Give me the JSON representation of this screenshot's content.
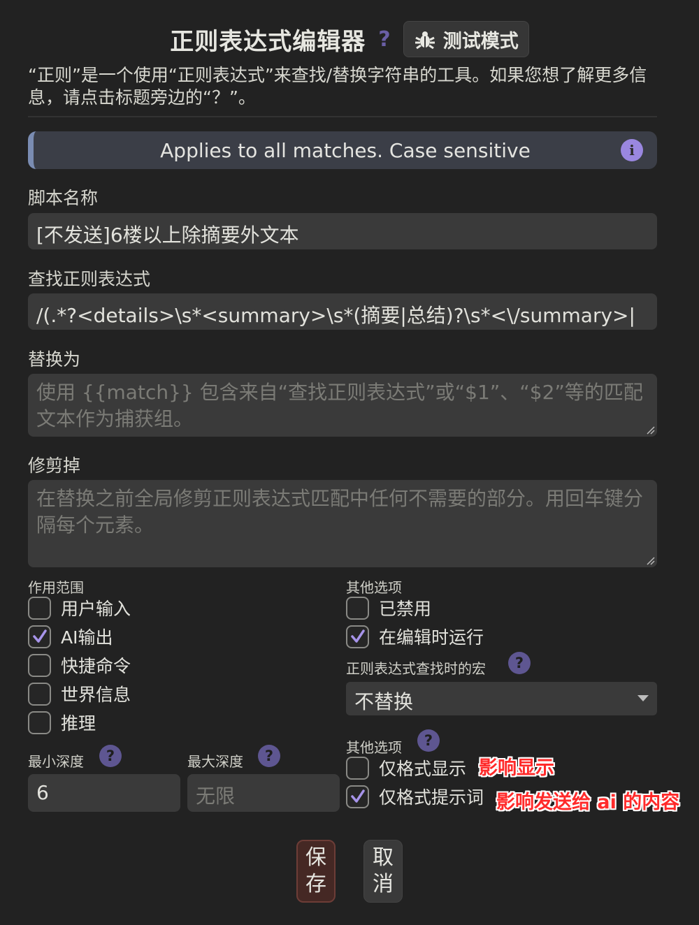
{
  "header": {
    "title": "正则表达式编辑器",
    "help_mark": "?",
    "test_mode_label": "测试模式",
    "description": "“正则”是一个使用“正则表达式”来查找/替换字符串的工具。如果您想了解更多信息，请点击标题旁边的“？”。"
  },
  "info_banner": {
    "text": "Applies to all matches. Case sensitive",
    "icon": "i"
  },
  "script_name": {
    "label": "脚本名称",
    "value": "[不发送]6楼以上除摘要外文本"
  },
  "find_regex": {
    "label": "查找正则表达式",
    "value": "/(.*?<details>\\s*<summary>\\s*(摘要|总结)?\\s*<\\/summary>|"
  },
  "replace_with": {
    "label": "替换为",
    "placeholder": "使用 {{match}} 包含来自“查找正则表达式”或“$1”、“$2”等的匹配文本作为捕获组。"
  },
  "trim_out": {
    "label": "修剪掉",
    "placeholder": "在替换之前全局修剪正则表达式匹配中任何不需要的部分。用回车键分隔每个元素。"
  },
  "scope": {
    "label": "作用范围",
    "items": [
      {
        "label": "用户输入",
        "checked": false
      },
      {
        "label": "AI输出",
        "checked": true
      },
      {
        "label": "快捷命令",
        "checked": false
      },
      {
        "label": "世界信息",
        "checked": false
      },
      {
        "label": "推理",
        "checked": false
      }
    ]
  },
  "other_options": {
    "label": "其他选项",
    "items": [
      {
        "label": "已禁用",
        "checked": false
      },
      {
        "label": "在编辑时运行",
        "checked": true
      }
    ]
  },
  "macro": {
    "label": "正则表达式查找时的宏",
    "help": "?",
    "selected": "不替换"
  },
  "depth": {
    "min_label": "最小深度",
    "min_help": "?",
    "min_value": "6",
    "max_label": "最大深度",
    "max_help": "?",
    "max_placeholder": "无限"
  },
  "other_options_2": {
    "label": "其他选项",
    "help": "?",
    "items": [
      {
        "label": "仅格式显示",
        "checked": false,
        "annotation": "影响显示"
      },
      {
        "label": "仅格式提示词",
        "checked": true,
        "annotation": "影响发送给 ai 的内容"
      }
    ]
  },
  "buttons": {
    "save_1": "保",
    "save_2": "存",
    "cancel_1": "取",
    "cancel_2": "消"
  },
  "colors": {
    "background": "#222222",
    "field": "#3a3a3a",
    "accent_purple": "#9a87e0",
    "annotation_red": "#ff2a2a",
    "save_button": "#452824"
  }
}
